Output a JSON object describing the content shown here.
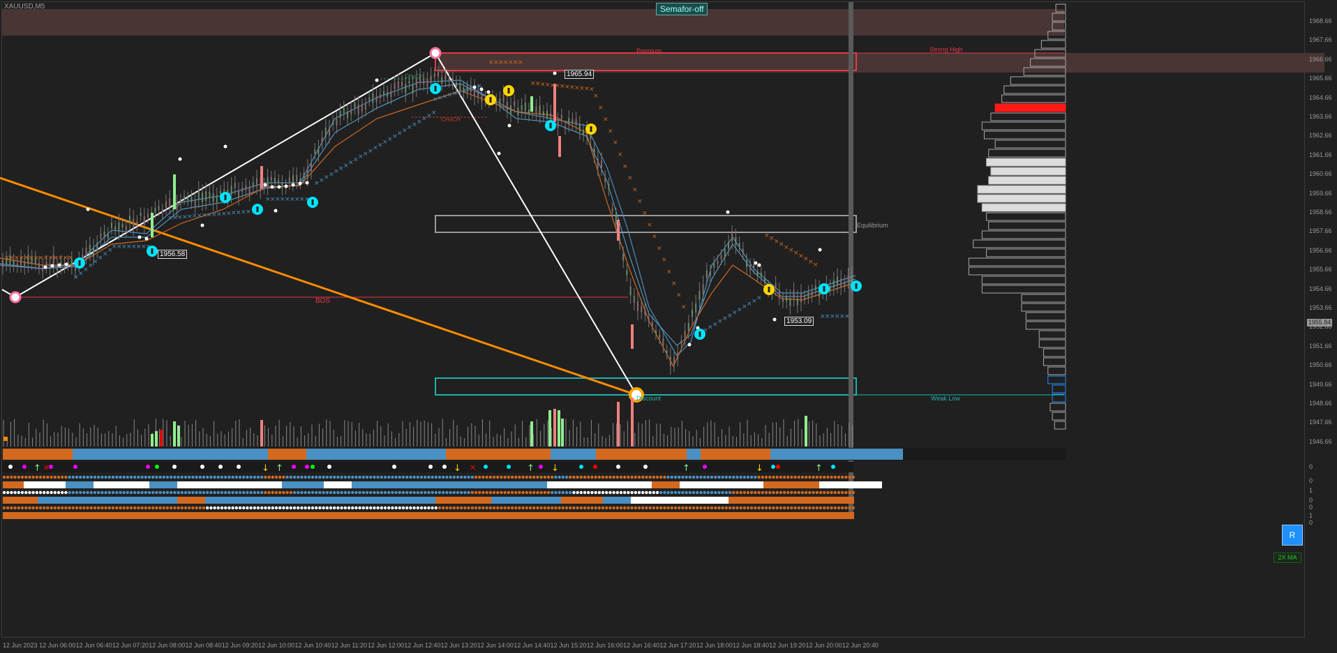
{
  "symbol": "XAUUSD,M5",
  "semafor_button": "Semafor-off",
  "price_axis": [
    "1968.66",
    "1967.66",
    "1966.66",
    "1965.66",
    "1964.66",
    "1963.66",
    "1962.66",
    "1961.66",
    "1960.66",
    "1959.66",
    "1958.66",
    "1957.66",
    "1956.66",
    "1955.66",
    "1954.66",
    "1953.66",
    "1952.66",
    "1951.66",
    "1950.66",
    "1949.66",
    "1948.66",
    "1947.66",
    "1946.66"
  ],
  "current_price": "1955.84",
  "time_axis": [
    "12 Jun 2023",
    "12 Jun 06:00",
    "12 Jun 06:40",
    "12 Jun 07:20",
    "12 Jun 08:00",
    "12 Jun 08:40",
    "12 Jun 09:20",
    "12 Jun 10:00",
    "12 Jun 10:40",
    "12 Jun 11:20",
    "12 Jun 12:00",
    "12 Jun 12:40",
    "12 Jun 13:20",
    "12 Jun 14:00",
    "12 Jun 14:40",
    "12 Jun 15:20",
    "12 Jun 16:00",
    "12 Jun 16:40",
    "12 Jun 17:20",
    "12 Jun 18:00",
    "12 Jun 18:40",
    "12 Jun 19:20",
    "12 Jun 20:00",
    "12 Jun 20:40"
  ],
  "zones": {
    "premium": "Premium",
    "strong_high": "Strong High",
    "equilibrium": "Equilibrium",
    "discount": "Discount",
    "weak_low": "Weak Low",
    "bos": "BOS",
    "choch_1": "CHoCH",
    "choch_2": "CHoCH"
  },
  "price_tags": [
    "1956.58",
    "1965.94",
    "1953.09"
  ],
  "indicator_button": "2X MA",
  "r_button": "R",
  "sub_panel_labels": [
    "0",
    "0",
    "1",
    "0",
    "0",
    "1",
    "0"
  ],
  "colors": {
    "background": "#202020",
    "bull_candle": "#90ee90",
    "bear_candle": "#f08080",
    "premium_zone": "#e63946",
    "equilibrium_zone": "#9a9a9a",
    "discount_zone": "#20b2aa",
    "trend_line": "#ff8c00",
    "ma_blue": "#4a90c2",
    "ma_orange": "#d2691e",
    "arrow_cyan": "#00e5ff",
    "arrow_yellow": "#ffd700"
  }
}
